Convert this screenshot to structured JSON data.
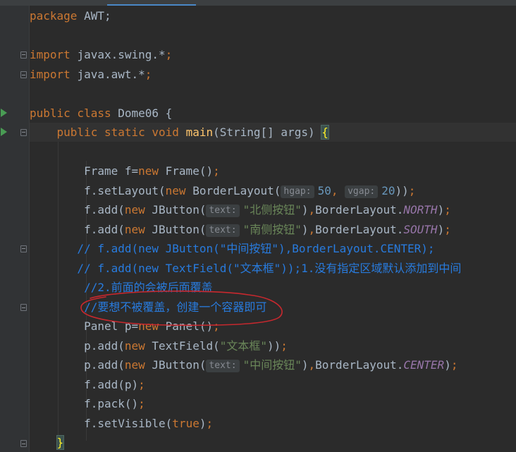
{
  "editor": {
    "language": "java",
    "lines": [
      {
        "key": "l1",
        "segments": [
          {
            "t": "package ",
            "c": "kw"
          },
          {
            "t": "AWT;"
          }
        ]
      },
      {
        "key": "l3",
        "segments": [
          {
            "t": "import ",
            "c": "kw"
          },
          {
            "t": "javax.swing.*"
          },
          {
            "t": ";",
            "c": "kw"
          }
        ]
      },
      {
        "key": "l4",
        "segments": [
          {
            "t": "import ",
            "c": "kw"
          },
          {
            "t": "java.awt.*"
          },
          {
            "t": ";",
            "c": "kw"
          }
        ]
      },
      {
        "key": "l6",
        "segments": [
          {
            "t": "public class ",
            "c": "kw"
          },
          {
            "t": "Dome06 {"
          }
        ]
      },
      {
        "key": "l7",
        "segments": [
          {
            "t": "    public static void ",
            "c": "kw"
          },
          {
            "t": "main",
            "c": "fn"
          },
          {
            "t": "(String[] args) "
          },
          {
            "t": "{",
            "c": "bracehl"
          }
        ]
      },
      {
        "key": "l9",
        "segments": [
          {
            "t": "        Frame f="
          },
          {
            "t": "new ",
            "c": "kw"
          },
          {
            "t": "Frame()"
          },
          {
            "t": ";",
            "c": "kw"
          }
        ]
      },
      {
        "key": "l10",
        "segments": [
          {
            "t": "        f.setLayout("
          },
          {
            "t": "new ",
            "c": "kw"
          },
          {
            "t": "BorderLayout("
          },
          {
            "t": "hgap:",
            "c": "hint"
          },
          {
            "t": "50",
            "c": "num"
          },
          {
            "t": ", ",
            "c": "kw"
          },
          {
            "t": "vgap:",
            "c": "hint"
          },
          {
            "t": "20",
            "c": "num"
          },
          {
            "t": "))"
          },
          {
            "t": ";",
            "c": "kw"
          }
        ]
      },
      {
        "key": "l11",
        "segments": [
          {
            "t": "        f.add("
          },
          {
            "t": "new ",
            "c": "kw"
          },
          {
            "t": "JButton("
          },
          {
            "t": "text:",
            "c": "hint"
          },
          {
            "t": "\"北侧按钮\"",
            "c": "str"
          },
          {
            "t": ")"
          },
          {
            "t": ",",
            "c": "kw"
          },
          {
            "t": "BorderLayout."
          },
          {
            "t": "NORTH",
            "c": "const"
          },
          {
            "t": ")"
          },
          {
            "t": ";",
            "c": "kw"
          }
        ]
      },
      {
        "key": "l12",
        "segments": [
          {
            "t": "        f.add("
          },
          {
            "t": "new ",
            "c": "kw"
          },
          {
            "t": "JButton("
          },
          {
            "t": "text:",
            "c": "hint"
          },
          {
            "t": "\"南侧按钮\"",
            "c": "str"
          },
          {
            "t": ")"
          },
          {
            "t": ",",
            "c": "kw"
          },
          {
            "t": "BorderLayout."
          },
          {
            "t": "SOUTH",
            "c": "const"
          },
          {
            "t": ")"
          },
          {
            "t": ";",
            "c": "kw"
          }
        ]
      },
      {
        "key": "l13",
        "segments": [
          {
            "t": "       // f.add(new JButton(\"中间按钮\"),BorderLayout.CENTER);",
            "c": "cmt"
          }
        ]
      },
      {
        "key": "l14",
        "segments": [
          {
            "t": "       // f.add(new TextField(\"文本框\"));1.没有指定区域默认添加到中间",
            "c": "cmt"
          }
        ]
      },
      {
        "key": "l15",
        "segments": [
          {
            "t": "        //2.前面的会被后面覆盖",
            "c": "cmt"
          }
        ]
      },
      {
        "key": "l16",
        "segments": [
          {
            "t": "        //要想不被覆盖，创建一个容器即可",
            "c": "cmt"
          }
        ]
      },
      {
        "key": "l17",
        "segments": [
          {
            "t": "        Panel p="
          },
          {
            "t": "new ",
            "c": "kw"
          },
          {
            "t": "Panel()"
          },
          {
            "t": ";",
            "c": "kw"
          }
        ]
      },
      {
        "key": "l18",
        "segments": [
          {
            "t": "        p.add("
          },
          {
            "t": "new ",
            "c": "kw"
          },
          {
            "t": "TextField("
          },
          {
            "t": "\"文本框\"",
            "c": "str"
          },
          {
            "t": "))"
          },
          {
            "t": ";",
            "c": "kw"
          }
        ]
      },
      {
        "key": "l19",
        "segments": [
          {
            "t": "        p.add("
          },
          {
            "t": "new ",
            "c": "kw"
          },
          {
            "t": "JButton("
          },
          {
            "t": "text:",
            "c": "hint"
          },
          {
            "t": "\"中间按钮\"",
            "c": "str"
          },
          {
            "t": ")"
          },
          {
            "t": ",",
            "c": "kw"
          },
          {
            "t": "BorderLayout."
          },
          {
            "t": "CENTER",
            "c": "const"
          },
          {
            "t": ")"
          },
          {
            "t": ";",
            "c": "kw"
          }
        ]
      },
      {
        "key": "l20",
        "segments": [
          {
            "t": "        f.add(p)"
          },
          {
            "t": ";",
            "c": "kw"
          }
        ]
      },
      {
        "key": "l21",
        "segments": [
          {
            "t": "        f.pack()"
          },
          {
            "t": ";",
            "c": "kw"
          }
        ]
      },
      {
        "key": "l22",
        "segments": [
          {
            "t": "        f.setVisible("
          },
          {
            "t": "true",
            "c": "kw"
          },
          {
            "t": ")"
          },
          {
            "t": ";",
            "c": "kw"
          }
        ]
      },
      {
        "key": "l23",
        "segments": [
          {
            "t": "    "
          },
          {
            "t": "}",
            "c": "bracehl"
          }
        ]
      }
    ]
  },
  "gutter": {
    "run_icons": [
      "run-class-icon",
      "run-main-icon"
    ],
    "fold_markers": [
      "fold-imports",
      "fold-main",
      "fold-comment-block",
      "fold-comment-2"
    ]
  },
  "annotation": {
    "shape": "hand-drawn-ellipse",
    "color": "#c8282e"
  },
  "colors": {
    "background": "#2b2b2b",
    "keyword": "#cc7832",
    "string": "#6a8759",
    "number": "#6897bb",
    "constant": "#9876aa",
    "method": "#ffc66d",
    "comment_highlighted": "#287bde"
  }
}
